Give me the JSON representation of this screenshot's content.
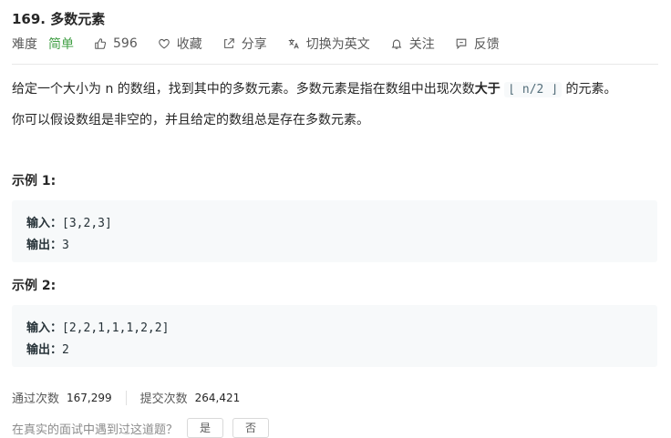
{
  "problem": {
    "title": "169. 多数元素",
    "difficulty_label": "难度",
    "difficulty": "简单",
    "likes": "596",
    "favorite_label": "收藏",
    "share_label": "分享",
    "translate_label": "切换为英文",
    "follow_label": "关注",
    "feedback_label": "反馈"
  },
  "description": {
    "p1_before": "给定一个大小为 n 的数组，找到其中的多数元素。多数元素是指在数组中出现次数",
    "p1_bold": "大于",
    "p1_code": "⌊ n/2 ⌋",
    "p1_after": "的元素。",
    "p2": "你可以假设数组是非空的，并且给定的数组总是存在多数元素。"
  },
  "examples": [
    {
      "title": "示例 1:",
      "input_label": "输入：",
      "input": "[3,2,3]",
      "output_label": "输出：",
      "output": "3"
    },
    {
      "title": "示例 2:",
      "input_label": "输入：",
      "input": "[2,2,1,1,1,2,2]",
      "output_label": "输出：",
      "output": "2"
    }
  ],
  "stats": {
    "accepted_label": "通过次数",
    "accepted": "167,299",
    "submissions_label": "提交次数",
    "submissions": "264,421"
  },
  "cutoff": {
    "text": "在真实的面试中遇到过这道题？",
    "yes": "是",
    "no": "否"
  },
  "colors": {
    "easy": "#43a047",
    "code_bg": "#f7f9fa"
  }
}
